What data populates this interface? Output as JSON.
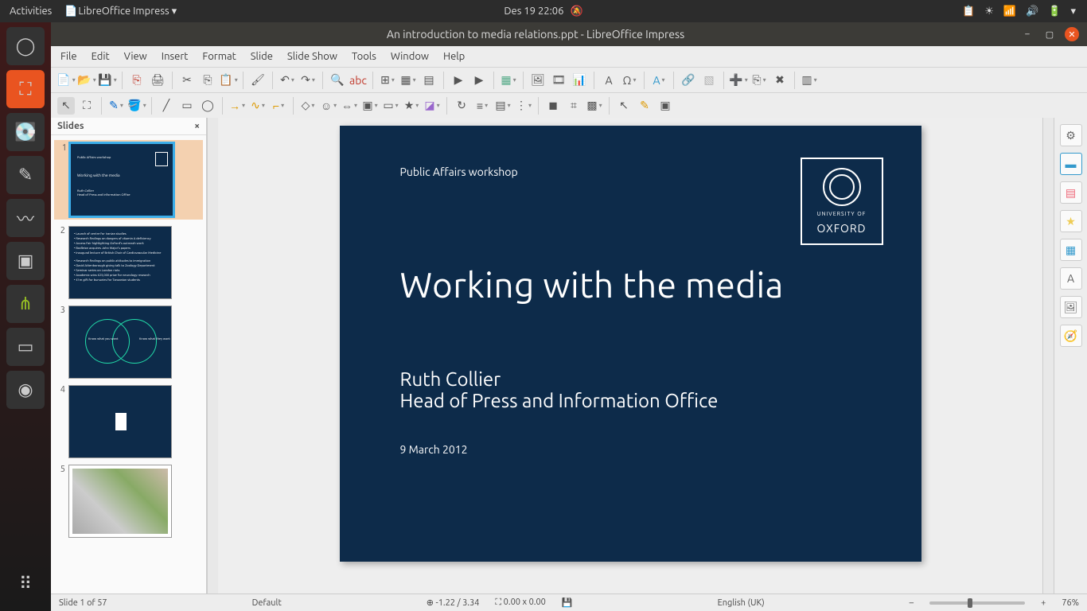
{
  "topbar": {
    "activities": "Activities",
    "app_menu": "LibreOffice Impress ▾",
    "datetime": "Des 19  22:06"
  },
  "window_title": "An introduction to media relations.ppt - LibreOffice Impress",
  "menu": [
    "File",
    "Edit",
    "View",
    "Insert",
    "Format",
    "Slide",
    "Slide Show",
    "Tools",
    "Window",
    "Help"
  ],
  "slidepanel": {
    "title": "Slides",
    "close": "×"
  },
  "slide": {
    "subtitle": "Public Affairs workshop",
    "title": "Working with the media",
    "author": "Ruth Collier",
    "role": "Head of Press and Information Office",
    "date": "9 March 2012",
    "logo_t1": "UNIVERSITY OF",
    "logo_t2": "OXFORD"
  },
  "status": {
    "slide": "Slide 1 of 57",
    "master": "Default",
    "pos": "-1.22 / 3.34",
    "size": "0.00 x 0.00",
    "lang": "English (UK)",
    "zoom": "76%"
  },
  "thumbs_text": {
    "s2": [
      "• Launch of centre for Iranian studies",
      "• Research findings on dangers of vitamin A deficiency",
      "• Access Fair highlighting Oxford's outreach work",
      "• Bodleian acquires John Major's papers",
      "• Inaugural lecture of British Chair of Cardiovascular Medicine",
      "• Research findings on public attitudes to immigration",
      "• David Attenborough giving talk to Zoology Department",
      "• Seminar series on London riots",
      "• Academic wins £25,000 prize for neurology research",
      "• £1m gift for bursaries for Tanzanian students"
    ],
    "s3": [
      "Know what you want",
      "Know what they want"
    ]
  }
}
